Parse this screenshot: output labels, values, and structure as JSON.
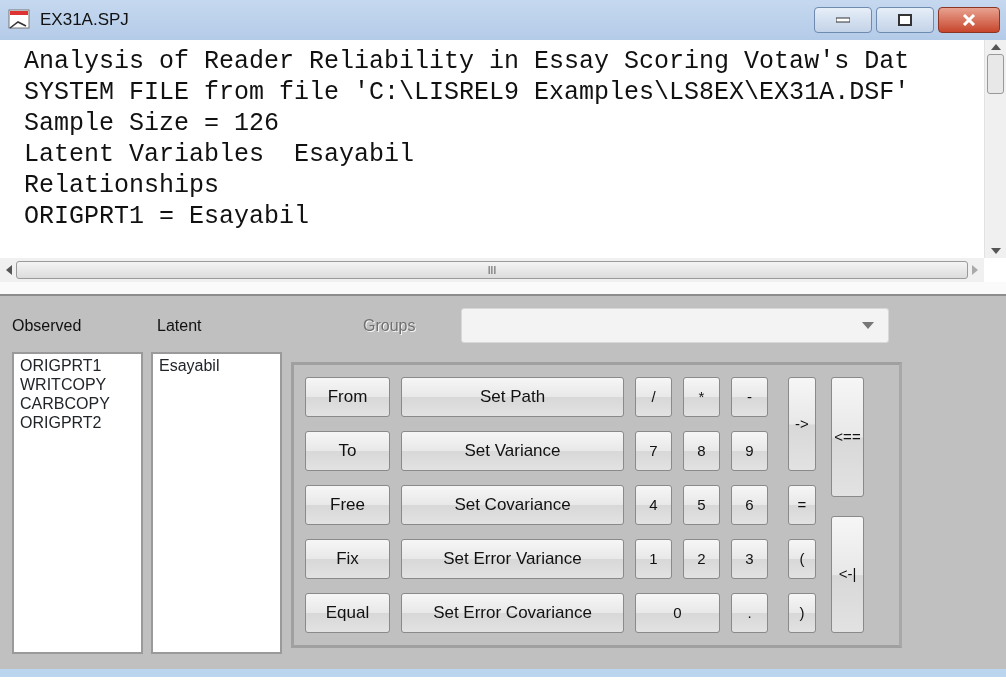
{
  "window": {
    "title": "EX31A.SPJ"
  },
  "editor": {
    "lines": [
      "Analysis of Reader Reliability in Essay Scoring Votaw's Dat",
      "SYSTEM FILE from file 'C:\\LISREL9 Examples\\LS8EX\\EX31A.DSF'",
      "Sample Size = 126",
      "Latent Variables  Esayabil",
      "Relationships",
      "ORIGPRT1 = Esayabil"
    ],
    "hscroll_grip": "III"
  },
  "observed": {
    "label": "Observed",
    "items": [
      "ORIGPRT1",
      "WRITCOPY",
      "CARBCOPY",
      "ORIGPRT2"
    ]
  },
  "latent": {
    "label": "Latent",
    "items": [
      "Esayabil"
    ]
  },
  "groups": {
    "label": "Groups",
    "disabled": true
  },
  "keypad": {
    "commands": [
      "From",
      "To",
      "Free",
      "Fix",
      "Equal"
    ],
    "set_buttons": [
      "Set Path",
      "Set Variance",
      "Set Covariance",
      "Set Error Variance",
      "Set Error Covariance"
    ],
    "keys": [
      "/",
      "*",
      "-",
      "7",
      "8",
      "9",
      "4",
      "5",
      "6",
      "1",
      "2",
      "3",
      "0",
      "."
    ],
    "operators": [
      "->",
      "=",
      "(",
      ")"
    ],
    "edit_buttons": [
      "<==",
      "<-|"
    ]
  }
}
